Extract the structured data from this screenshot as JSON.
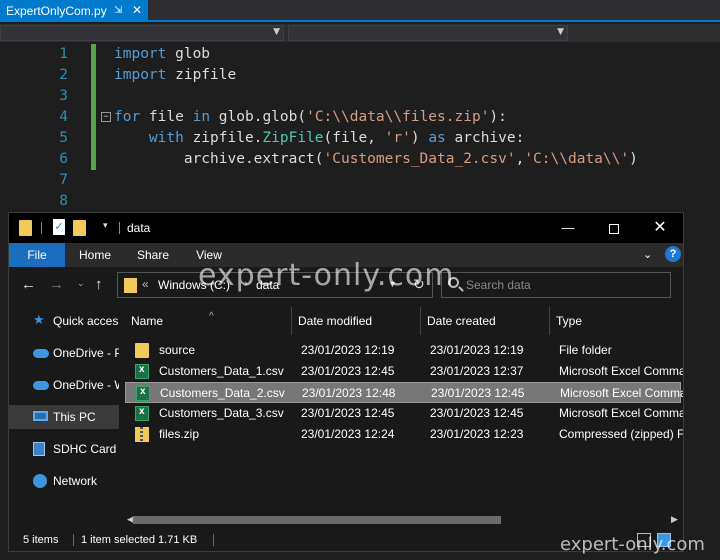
{
  "editor": {
    "tab_title": "ExpertOnlyCom.py",
    "tab_pin": "⇲",
    "tab_close": "✕",
    "lines": [
      {
        "n": "1",
        "parts": [
          {
            "t": "import",
            "c": "kw"
          },
          {
            "t": " glob",
            "c": "plain"
          }
        ]
      },
      {
        "n": "2",
        "parts": [
          {
            "t": "import",
            "c": "kw"
          },
          {
            "t": " zipfile",
            "c": "plain"
          }
        ]
      },
      {
        "n": "3",
        "parts": []
      },
      {
        "n": "4",
        "parts": [
          {
            "t": "for",
            "c": "kw"
          },
          {
            "t": " file ",
            "c": "plain"
          },
          {
            "t": "in",
            "c": "kw"
          },
          {
            "t": " glob.glob(",
            "c": "plain"
          },
          {
            "t": "'C:\\\\data\\\\files.zip'",
            "c": "str"
          },
          {
            "t": "):",
            "c": "plain"
          }
        ]
      },
      {
        "n": "5",
        "parts": [
          {
            "t": "    ",
            "c": "plain"
          },
          {
            "t": "with",
            "c": "kw"
          },
          {
            "t": " zipfile.",
            "c": "plain"
          },
          {
            "t": "ZipFile",
            "c": "cls"
          },
          {
            "t": "(file, ",
            "c": "plain"
          },
          {
            "t": "'r'",
            "c": "str"
          },
          {
            "t": ") ",
            "c": "plain"
          },
          {
            "t": "as",
            "c": "kw"
          },
          {
            "t": " archive:",
            "c": "plain"
          }
        ]
      },
      {
        "n": "6",
        "parts": [
          {
            "t": "        archive.extract(",
            "c": "plain"
          },
          {
            "t": "'Customers_Data_2.csv'",
            "c": "str"
          },
          {
            "t": ",",
            "c": "plain"
          },
          {
            "t": "'C:\\\\data\\\\'",
            "c": "str"
          },
          {
            "t": ")",
            "c": "plain"
          }
        ]
      },
      {
        "n": "7",
        "parts": []
      },
      {
        "n": "8",
        "parts": []
      }
    ]
  },
  "explorer": {
    "window_title": "data",
    "window_buttons": {
      "minimize": "—",
      "close": "✕"
    },
    "ribbon_tabs": [
      "File",
      "Home",
      "Share",
      "View"
    ],
    "ribbon_caret": "⌄",
    "help": "?",
    "nav_buttons": {
      "back": "←",
      "forward": "→",
      "recent": "⌄",
      "up": "↑",
      "refresh": "↻"
    },
    "address": {
      "chevron": "«",
      "crumbs": [
        "Windows (C:)",
        "data"
      ],
      "separator": "›"
    },
    "search": {
      "placeholder": "Search data"
    },
    "nav_pane": [
      {
        "label": "Quick access",
        "icon": "star-icon"
      },
      {
        "label": "OneDrive - Personal",
        "icon": "cloud-icon"
      },
      {
        "label": "OneDrive - Work",
        "icon": "cloud-icon"
      },
      {
        "label": "This PC",
        "icon": "computer-icon",
        "selected": true
      },
      {
        "label": "SDHC Card",
        "icon": "sd-card-icon"
      },
      {
        "label": "Network",
        "icon": "network-icon"
      }
    ],
    "columns": [
      "Name",
      "Date modified",
      "Date created",
      "Type"
    ],
    "sort_caret": "^",
    "files": [
      {
        "name": "source",
        "modified": "23/01/2023 12:19",
        "created": "23/01/2023 12:19",
        "type": "File folder",
        "icon": "folder"
      },
      {
        "name": "Customers_Data_1.csv",
        "modified": "23/01/2023 12:45",
        "created": "23/01/2023 12:37",
        "type": "Microsoft Excel Comma Sep",
        "icon": "xls"
      },
      {
        "name": "Customers_Data_2.csv",
        "modified": "23/01/2023 12:48",
        "created": "23/01/2023 12:45",
        "type": "Microsoft Excel Comma Sep",
        "icon": "xls",
        "selected": true
      },
      {
        "name": "Customers_Data_3.csv",
        "modified": "23/01/2023 12:45",
        "created": "23/01/2023 12:45",
        "type": "Microsoft Excel Comma Sep",
        "icon": "xls"
      },
      {
        "name": "files.zip",
        "modified": "23/01/2023 12:24",
        "created": "23/01/2023 12:23",
        "type": "Compressed (zipped) Fold",
        "icon": "zip"
      }
    ],
    "status": {
      "items_count": "5 items",
      "selection": "1 item selected  1.71 KB"
    }
  },
  "watermark": {
    "main": "expert-only.com",
    "corner": "expert-only.com"
  }
}
